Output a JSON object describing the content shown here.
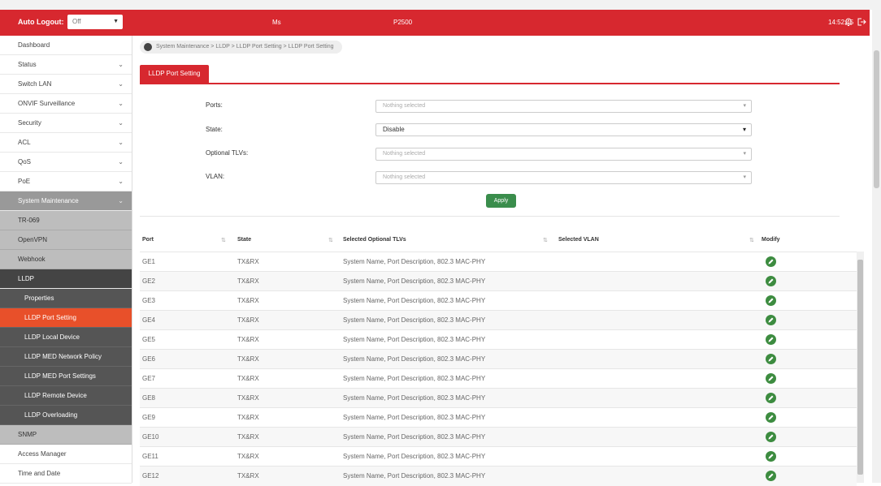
{
  "header": {
    "auto_logout_label": "Auto Logout:",
    "auto_logout_value": "Off",
    "model": "Ms",
    "device_name": "P2500",
    "time": "14:52:45",
    "brand_color": "#d7282f"
  },
  "sidebar": {
    "items": [
      {
        "label": "Dashboard",
        "chevron": ""
      },
      {
        "label": "Status",
        "chevron": "⌄"
      },
      {
        "label": "Switch LAN",
        "chevron": "⌄"
      },
      {
        "label": "ONVIF Surveillance",
        "chevron": "⌄"
      },
      {
        "label": "Security",
        "chevron": "⌄"
      },
      {
        "label": "ACL",
        "chevron": "⌄"
      },
      {
        "label": "QoS",
        "chevron": "⌄"
      },
      {
        "label": "PoE",
        "chevron": "⌄"
      },
      {
        "label": "System Maintenance",
        "chevron": "⌄"
      },
      {
        "label": "TR-069"
      },
      {
        "label": "OpenVPN"
      },
      {
        "label": "Webhook"
      },
      {
        "label": "LLDP"
      },
      {
        "label": "Properties"
      },
      {
        "label": "LLDP Port Setting"
      },
      {
        "label": "LLDP Local Device"
      },
      {
        "label": "LLDP MED Network Policy"
      },
      {
        "label": "LLDP MED Port Settings"
      },
      {
        "label": "LLDP Remote Device"
      },
      {
        "label": "LLDP Overloading"
      },
      {
        "label": "SNMP"
      },
      {
        "label": "Access Manager"
      },
      {
        "label": "Time and Date"
      }
    ]
  },
  "breadcrumb": "System Maintenance > LLDP > LLDP Port Setting > LLDP Port Setting",
  "tab": "LLDP Port Setting",
  "form": {
    "ports_label": "Ports:",
    "ports_value": "Nothing selected",
    "state_label": "State:",
    "state_value": "Disable",
    "tlvs_label": "Optional TLVs:",
    "tlvs_value": "Nothing selected",
    "vlan_label": "VLAN:",
    "vlan_value": "Nothing selected",
    "apply": "Apply"
  },
  "table": {
    "headers": [
      "Port",
      "State",
      "Selected Optional TLVs",
      "Selected VLAN",
      "Modify"
    ],
    "rows": [
      {
        "port": "GE1",
        "state": "TX&RX",
        "tlvs": "System Name, Port Description, 802.3 MAC-PHY",
        "vlan": ""
      },
      {
        "port": "GE2",
        "state": "TX&RX",
        "tlvs": "System Name, Port Description, 802.3 MAC-PHY",
        "vlan": ""
      },
      {
        "port": "GE3",
        "state": "TX&RX",
        "tlvs": "System Name, Port Description, 802.3 MAC-PHY",
        "vlan": ""
      },
      {
        "port": "GE4",
        "state": "TX&RX",
        "tlvs": "System Name, Port Description, 802.3 MAC-PHY",
        "vlan": ""
      },
      {
        "port": "GE5",
        "state": "TX&RX",
        "tlvs": "System Name, Port Description, 802.3 MAC-PHY",
        "vlan": ""
      },
      {
        "port": "GE6",
        "state": "TX&RX",
        "tlvs": "System Name, Port Description, 802.3 MAC-PHY",
        "vlan": ""
      },
      {
        "port": "GE7",
        "state": "TX&RX",
        "tlvs": "System Name, Port Description, 802.3 MAC-PHY",
        "vlan": ""
      },
      {
        "port": "GE8",
        "state": "TX&RX",
        "tlvs": "System Name, Port Description, 802.3 MAC-PHY",
        "vlan": ""
      },
      {
        "port": "GE9",
        "state": "TX&RX",
        "tlvs": "System Name, Port Description, 802.3 MAC-PHY",
        "vlan": ""
      },
      {
        "port": "GE10",
        "state": "TX&RX",
        "tlvs": "System Name, Port Description, 802.3 MAC-PHY",
        "vlan": ""
      },
      {
        "port": "GE11",
        "state": "TX&RX",
        "tlvs": "System Name, Port Description, 802.3 MAC-PHY",
        "vlan": ""
      },
      {
        "port": "GE12",
        "state": "TX&RX",
        "tlvs": "System Name, Port Description, 802.3 MAC-PHY",
        "vlan": ""
      }
    ]
  }
}
